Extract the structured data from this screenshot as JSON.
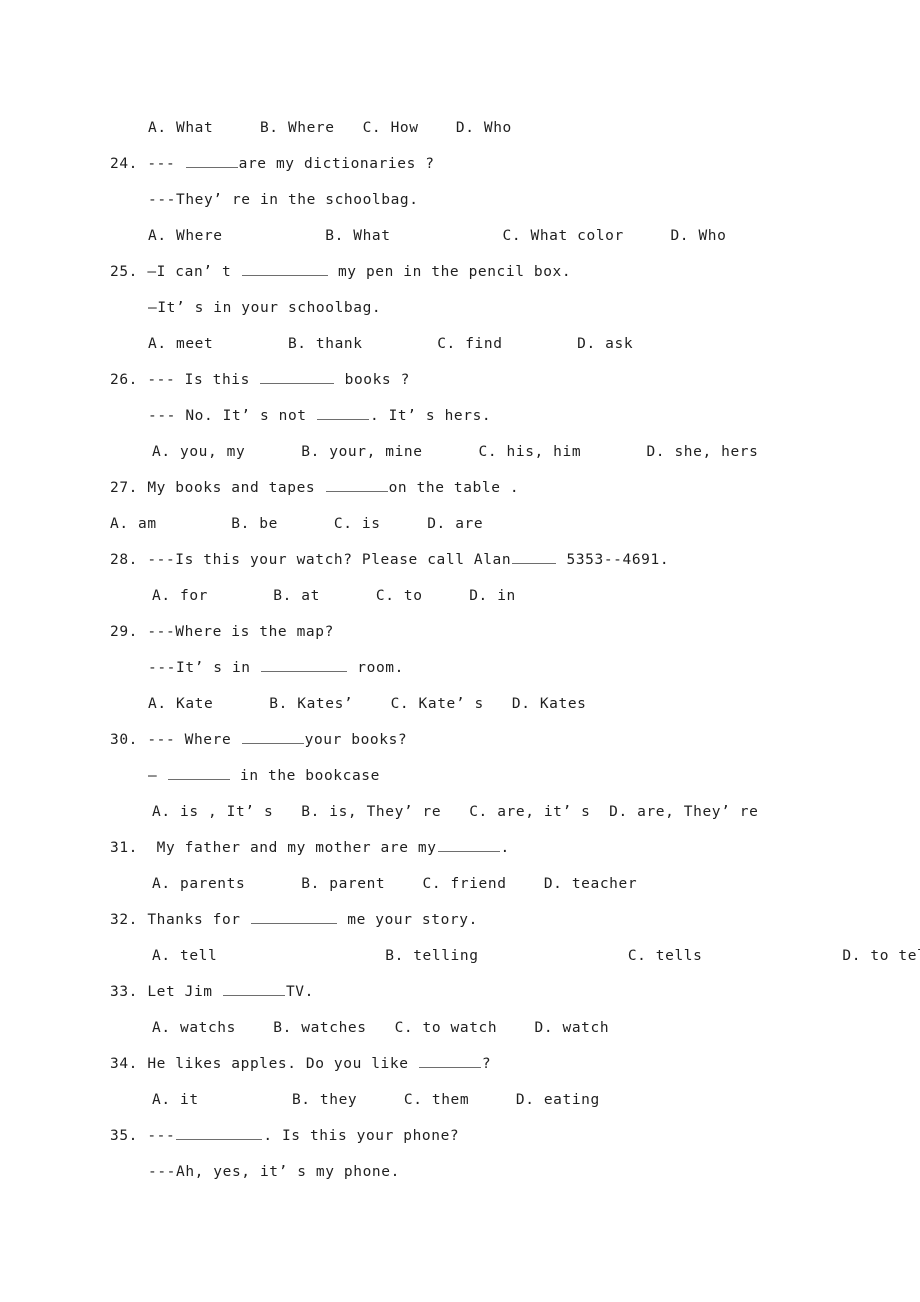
{
  "document": {
    "type": "english-exam-worksheet",
    "page_background": "#ffffff",
    "text_color": "#1f1f1f",
    "blank_rule_color": "#6e6e6e"
  },
  "lines": {
    "q23_options": "A. What     B. Where   C. How    D. Who",
    "q24_stem_a": "24. --- ",
    "q24_stem_b": "are my dictionaries ?",
    "q24_reply": "---They’ re in the schoolbag.",
    "q24_options": "A. Where           B. What            C. What color     D. Who",
    "q25_stem_a": "25. —I can’ t ",
    "q25_stem_b": " my pen in the pencil box.",
    "q25_reply": "—It’ s in your schoolbag.",
    "q25_options": "A. meet        B. thank        C. find        D. ask",
    "q26_stem_a": "26. --- Is this ",
    "q26_stem_b": " books ?",
    "q26_reply_a": "--- No. It’ s not ",
    "q26_reply_b": ". It’ s hers.",
    "q26_options": "A. you, my      B. your, mine      C. his, him       D. she, hers",
    "q27_stem_a": "27. My books and tapes ",
    "q27_stem_b": "on the table .",
    "q27_options": "A. am        B. be      C. is     D. are",
    "q28_stem_a": "28. ---Is this your watch? Please call Alan",
    "q28_stem_b": " 5353--4691.",
    "q28_options": "A. for       B. at      C. to     D. in",
    "q29_stem": "29. ---Where is the map?",
    "q29_reply_a": "---It’ s in ",
    "q29_reply_b": " room.",
    "q29_options": "A. Kate      B. Kates’    C. Kate’ s   D. Kates",
    "q30_stem_a": "30. --- Where ",
    "q30_stem_b": "your books?",
    "q30_reply_a": "— ",
    "q30_reply_b": " in the bookcase",
    "q30_options": "A. is , It’ s   B. is, They’ re   C. are, it’ s  D. are, They’ re",
    "q31_stem_a": "31.  My father and my mother are my",
    "q31_stem_b": ".",
    "q31_options": "A. parents      B. parent    C. friend    D. teacher",
    "q32_stem_a": "32. Thanks for ",
    "q32_stem_b": " me your story.",
    "q32_options": "A. tell                  B. telling                C. tells               D. to tell",
    "q33_stem_a": "33. Let Jim ",
    "q33_stem_b": "TV.",
    "q33_options": "A. watchs    B. watches   C. to watch    D. watch",
    "q34_stem_a": "34. He likes apples. Do you like ",
    "q34_stem_b": "?",
    "q34_options": "A. it          B. they     C. them     D. eating",
    "q35_stem_a": "35. ---",
    "q35_stem_b": ". Is this your phone?",
    "q35_reply": "---Ah, yes, it’ s my phone."
  }
}
